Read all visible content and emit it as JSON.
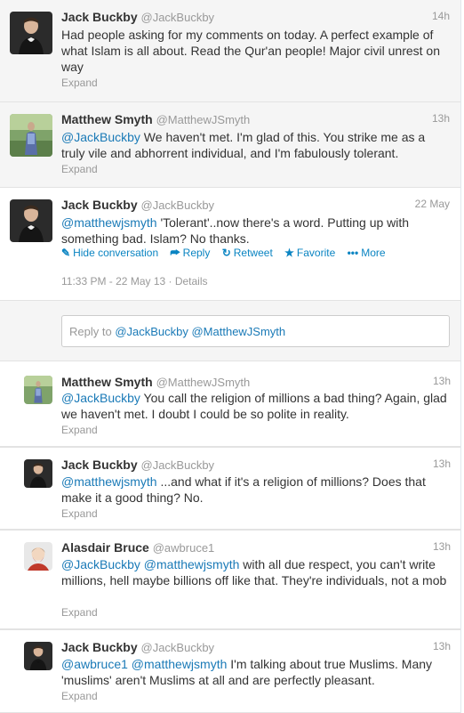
{
  "tweets": [
    {
      "fullname": "Jack Buckby",
      "username": "@JackBuckby",
      "time": "14h",
      "text": "Had people asking for my comments on today. A perfect example of what Islam is all about. Read the Qur'an people! Major civil unrest on way",
      "expand": "Expand"
    },
    {
      "fullname": "Matthew Smyth",
      "username": "@MatthewJSmyth",
      "time": "13h",
      "mention": "@JackBuckby",
      "text": " We haven't met. I'm glad of this. You strike me as a truly vile and abhorrent individual, and I'm fabulously tolerant.",
      "expand": "Expand"
    },
    {
      "fullname": "Jack Buckby",
      "username": "@JackBuckby",
      "time": "22 May",
      "mention": "@matthewjsmyth",
      "text": " 'Tolerant'..now there's a word. Putting up with something bad. Islam? No thanks.",
      "actions": {
        "hide": "Hide conversation",
        "reply": "Reply",
        "retweet": "Retweet",
        "favorite": "Favorite",
        "more": "More"
      },
      "meta": "11:33 PM - 22 May 13 · Details"
    }
  ],
  "reply_box": {
    "prefix": "Reply to ",
    "mentions": "@JackBuckby @MatthewJSmyth"
  },
  "replies": [
    {
      "fullname": "Matthew Smyth",
      "username": "@MatthewJSmyth",
      "time": "13h",
      "mention": "@JackBuckby",
      "text": " You call the religion of millions a bad thing? Again, glad we haven't met. I doubt I could be so polite in reality.",
      "expand": "Expand"
    },
    {
      "fullname": "Jack Buckby",
      "username": "@JackBuckby",
      "time": "13h",
      "mention": "@matthewjsmyth",
      "text": " ...and what if it's a religion of millions? Does that make it a good thing? No.",
      "expand": "Expand"
    },
    {
      "fullname": "Alasdair Bruce",
      "username": "@awbruce1",
      "time": "13h",
      "mention": "@JackBuckby @matthewjsmyth",
      "text": " with all due respect, you can't write millions, hell maybe billions off like that. They're individuals, not a mob",
      "expand": "Expand"
    },
    {
      "fullname": "Jack Buckby",
      "username": "@JackBuckby",
      "time": "13h",
      "mention": "@awbruce1 @matthewjsmyth",
      "text": " I'm talking about true Muslims. Many 'muslims' aren't Muslims at all and are perfectly pleasant.",
      "expand": "Expand"
    }
  ],
  "colors": {
    "link": "#1a7ab7",
    "action": "#0a84c2",
    "muted": "#999999",
    "background_alt": "#f5f5f5"
  },
  "icons": [
    "person-avatar",
    "reply-arrow-icon",
    "retweet-icon",
    "favorite-star-icon",
    "more-dots-icon",
    "hide-conversation-icon"
  ]
}
